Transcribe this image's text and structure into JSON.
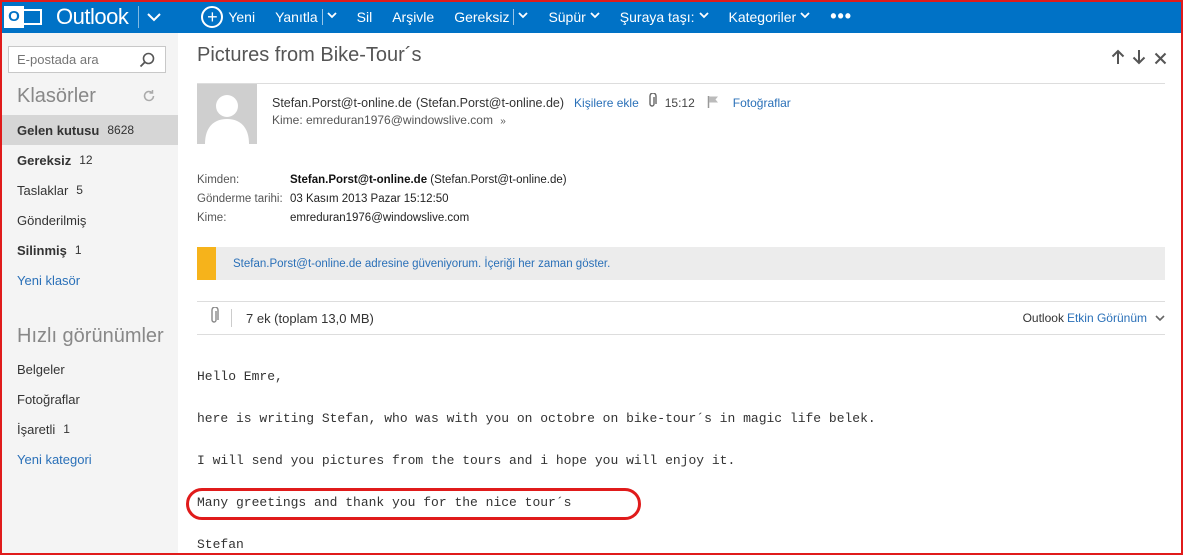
{
  "topbar": {
    "logo_letter": "O",
    "app_name": "Outlook",
    "commands": {
      "new": "Yeni",
      "reply": "Yanıtla",
      "delete": "Sil",
      "archive": "Arşivle",
      "junk": "Gereksiz",
      "sweep": "Süpür",
      "move_to": "Şuraya taşı:",
      "categories": "Kategoriler",
      "more": "•••"
    },
    "colors": {
      "bar": "#0072c6",
      "text": "#ffffff"
    }
  },
  "leftnav": {
    "search_placeholder": "E-postada ara",
    "folders_heading": "Klasörler",
    "folders": [
      {
        "label": "Gelen kutusu",
        "count": "8628"
      },
      {
        "label": "Gereksiz",
        "count": "12"
      },
      {
        "label": "Taslaklar",
        "count": "5"
      },
      {
        "label": "Gönderilmiş",
        "count": ""
      },
      {
        "label": "Silinmiş",
        "count": "1"
      }
    ],
    "new_folder": "Yeni klasör",
    "quick_views_heading": "Hızlı görünümler",
    "quick_views": [
      {
        "label": "Belgeler",
        "count": ""
      },
      {
        "label": "Fotoğraflar",
        "count": ""
      },
      {
        "label": "İşaretli",
        "count": "1"
      }
    ],
    "new_category": "Yeni kategori"
  },
  "message": {
    "subject": "Pictures from Bike-Tour´s",
    "sender_email": "Stefan.Porst@t-online.de",
    "sender_paren": "(Stefan.Porst@t-online.de)",
    "add_contact": "Kişilere ekle",
    "time": "15:12",
    "category": "Fotoğraflar",
    "to_line": "Kime: emreduran1976@windowslive.com",
    "from_label": "Kimden:",
    "from_value_bold": "Stefan.Porst@t-online.de",
    "from_value_paren": "(Stefan.Porst@t-online.de)",
    "sent_label": "Gönderme tarihi:",
    "sent_value": "03 Kasım 2013 Pazar 15:12:50",
    "to_label": "Kime:",
    "to_value": "emreduran1976@windowslive.com",
    "trust_text": "Stefan.Porst@t-online.de adresine güveniyorum. İçeriği her zaman göster.",
    "attachments": "7 ek (toplam 13,0 MB)",
    "view_prefix": "Outlook",
    "view_link": "Etkin Görünüm",
    "body": [
      "Hello Emre,",
      "here is writing Stefan, who was with you on octobre on bike-tour´s in magic life belek.",
      "I will send you pictures from the tours and i hope you will enjoy it.",
      "Many greetings and thank you for the nice tour´s",
      "Stefan"
    ],
    "colors": {
      "link": "#2a70b8",
      "trust_bar": "#f6b31b",
      "annotation": "#e01b1b"
    }
  }
}
